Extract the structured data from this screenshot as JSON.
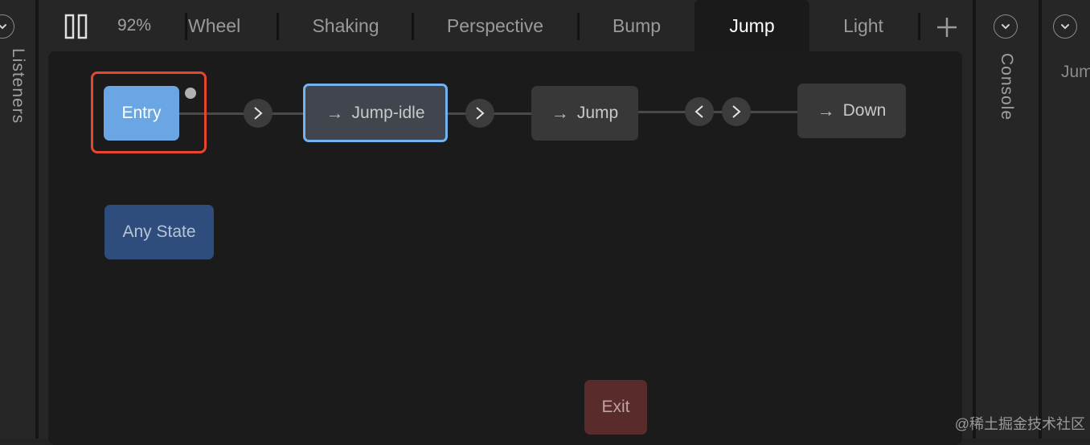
{
  "left_panel": {
    "label": "Listeners"
  },
  "toolbar": {
    "zoom": "92%",
    "pause_icon": "pause-icon"
  },
  "tabs": [
    {
      "label": "Wheel"
    },
    {
      "label": "Shaking"
    },
    {
      "label": "Perspective"
    },
    {
      "label": "Bump"
    },
    {
      "label": "Jump"
    },
    {
      "label": "Light"
    }
  ],
  "active_tab": "Jump",
  "add_tab_icon": "plus-icon",
  "graph": {
    "nodes": {
      "entry": "Entry",
      "jump_idle": "Jump-idle",
      "jump": "Jump",
      "down": "Down",
      "any_state": "Any State",
      "exit": "Exit"
    },
    "transition_arrow_right": ">",
    "transition_arrow_left": "<",
    "state_arrow": "→"
  },
  "right_panels": {
    "console": "Console",
    "partial_label": "Jum"
  },
  "watermark": "@稀土掘金技术社区",
  "colors": {
    "entry": "#6aa6e4",
    "any_state": "#2f4d7c",
    "exit": "#5a2b2b",
    "selected_border": "#74b2ee",
    "highlight": "#e8452e"
  }
}
